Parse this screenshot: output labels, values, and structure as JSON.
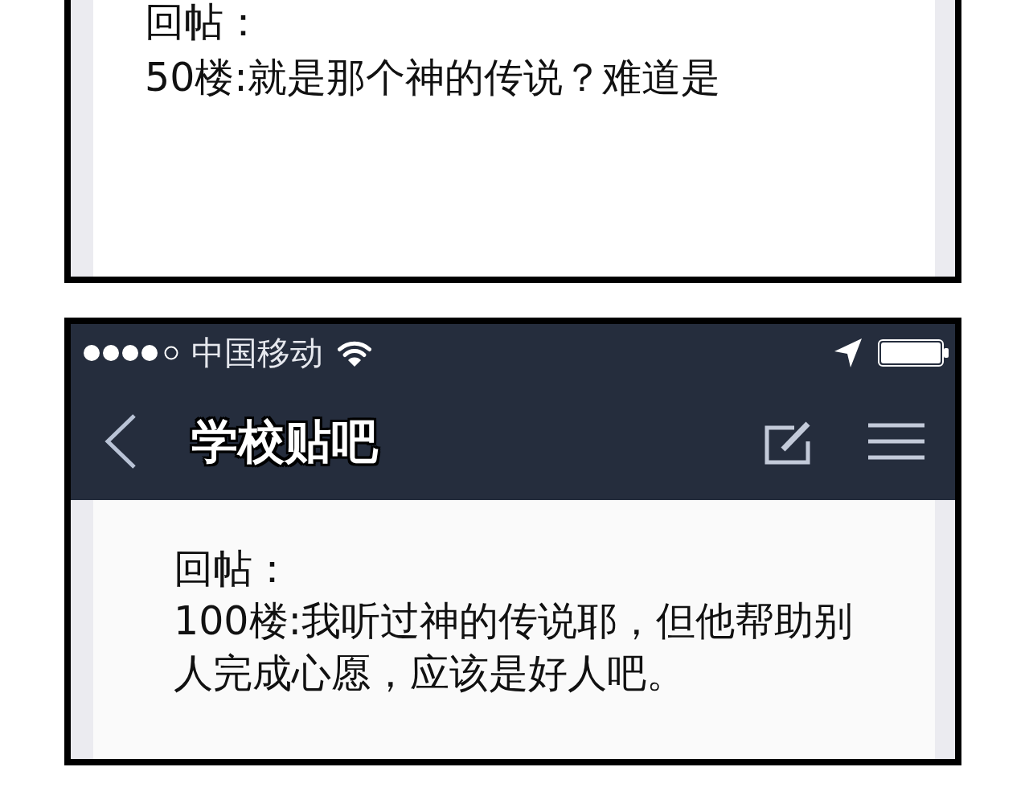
{
  "panels": [
    {
      "kind": "plain",
      "reply_label": "回帖：",
      "body": "50楼:就是那个神的传说？难道是"
    },
    {
      "kind": "phone",
      "status_bar": {
        "carrier": "中国移动"
      },
      "nav_bar": {
        "title": "学校贴吧"
      },
      "reply_label": "回帖：",
      "body": "100楼:我听过神的传说耶，但他帮助别人完成心愿，应该是好人吧。"
    }
  ]
}
